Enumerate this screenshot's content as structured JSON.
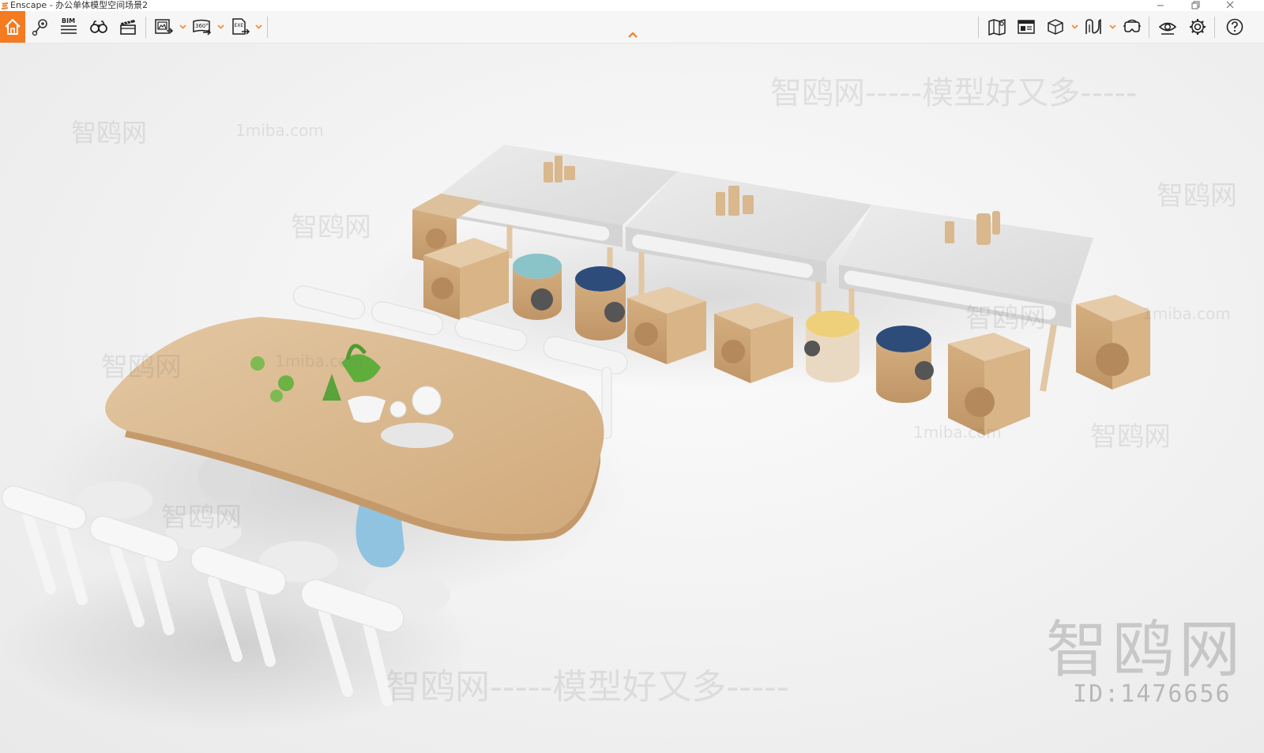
{
  "window": {
    "app_name": "Enscape",
    "title": "Enscape - 办公单体模型空间场景2",
    "controls": [
      "minimize-icon",
      "restore-icon",
      "close-icon"
    ]
  },
  "toolbar": {
    "accent_color": "#f47b20",
    "left_items": [
      {
        "id": "home",
        "icon": "home-icon"
      },
      {
        "id": "views",
        "icon": "location-pin-icon"
      },
      {
        "id": "bim",
        "icon": "bim-icon",
        "label": "BIM"
      },
      {
        "id": "binoculars",
        "icon": "binoculars-icon"
      },
      {
        "id": "video",
        "icon": "clapperboard-icon"
      },
      {
        "id": "screenshot",
        "icon": "render-image-icon"
      },
      {
        "id": "panorama",
        "icon": "panorama-icon",
        "label": "360°"
      },
      {
        "id": "export",
        "icon": "export-exe-icon",
        "label": "EXE"
      }
    ],
    "right_items": [
      {
        "id": "map",
        "icon": "map-icon"
      },
      {
        "id": "media",
        "icon": "media-window-icon"
      },
      {
        "id": "asset",
        "icon": "cube-icon"
      },
      {
        "id": "materials",
        "icon": "material-icon"
      },
      {
        "id": "vr",
        "icon": "vr-headset-icon"
      },
      {
        "id": "visibility",
        "icon": "eye-icon"
      },
      {
        "id": "settings",
        "icon": "gear-icon"
      },
      {
        "id": "help",
        "icon": "help-icon"
      }
    ]
  },
  "viewport": {
    "description_icon": "3d-render-viewport",
    "watermarks": {
      "site_text": "1miba.com",
      "brand_text": "智鸥网",
      "slogan": "智鸥网-----模型好又多-----",
      "big_brand": "智鸥网",
      "id_text": "ID:1476656"
    }
  }
}
